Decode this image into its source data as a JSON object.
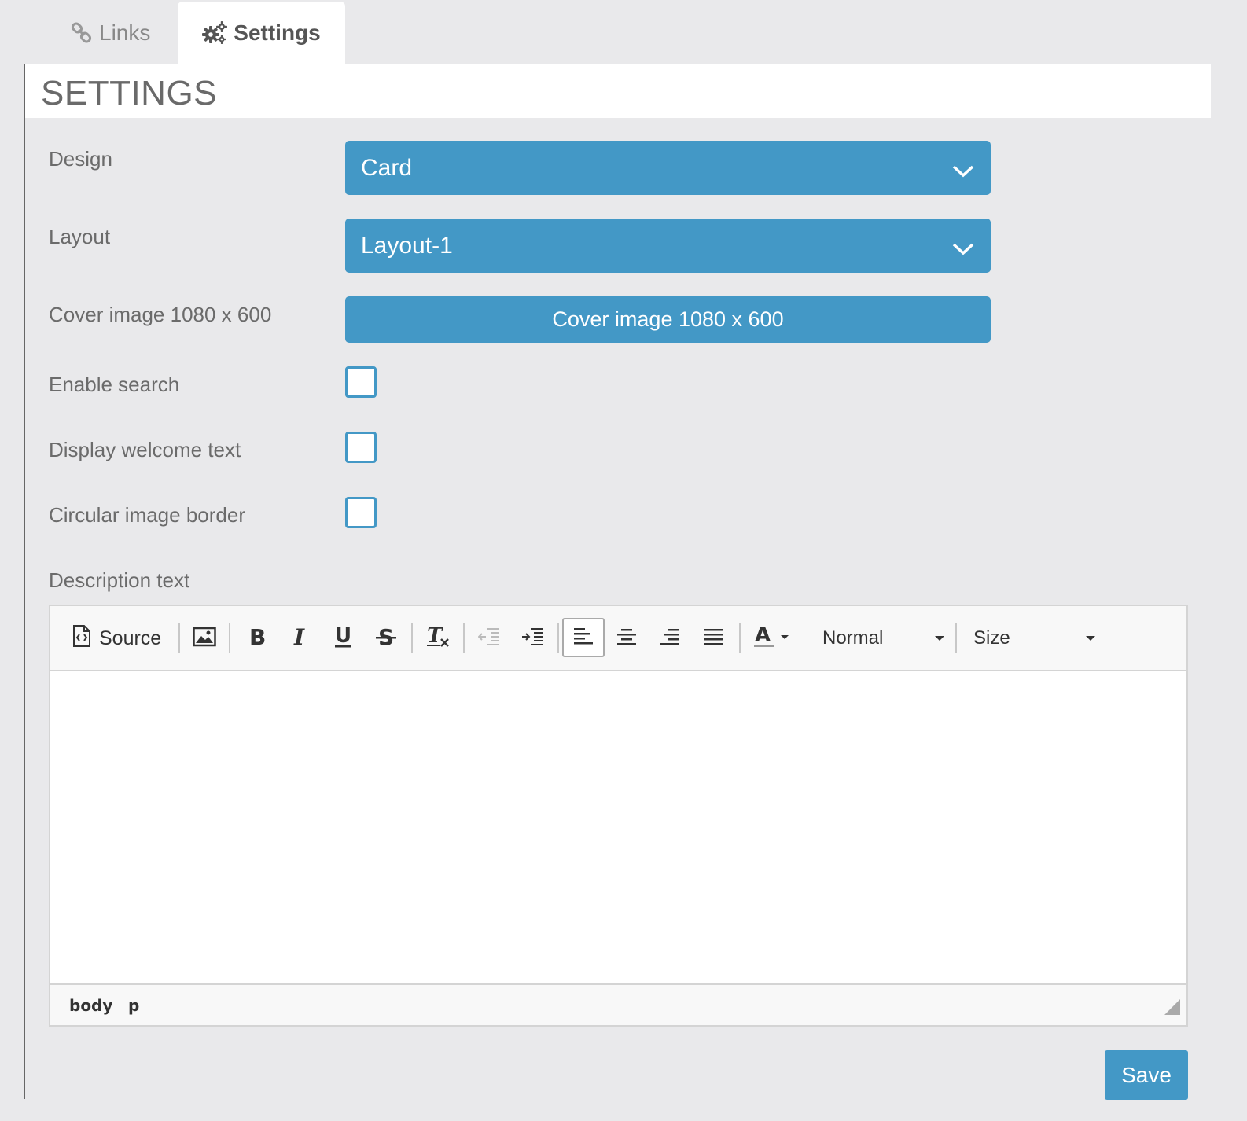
{
  "tabs": [
    {
      "label": "Links",
      "icon": "link-icon",
      "active": false
    },
    {
      "label": "Settings",
      "icon": "gears-icon",
      "active": true
    }
  ],
  "page_title": "SETTINGS",
  "form": {
    "design": {
      "label": "Design",
      "value": "Card"
    },
    "layout": {
      "label": "Layout",
      "value": "Layout-1"
    },
    "cover_image": {
      "label": "Cover image 1080 x 600",
      "button_label": "Cover image 1080 x 600"
    },
    "enable_search": {
      "label": "Enable search",
      "checked": false
    },
    "display_welcome": {
      "label": "Display welcome text",
      "checked": false
    },
    "circular_border": {
      "label": "Circular image border",
      "checked": false
    },
    "description": {
      "label": "Description text"
    }
  },
  "editor": {
    "toolbar": {
      "source_label": "Source",
      "format_value": "Normal",
      "size_value": "Size"
    },
    "path": [
      "body",
      "p"
    ]
  },
  "save_label": "Save",
  "colors": {
    "accent": "#4398c6",
    "background": "#e9e9eb"
  }
}
